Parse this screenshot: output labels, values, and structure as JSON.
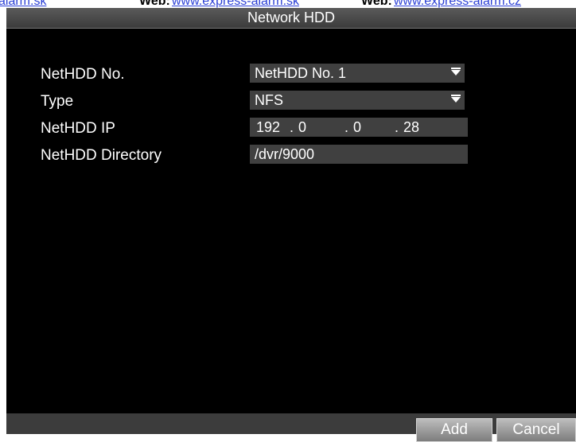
{
  "web_header": {
    "left_link": "alarm.sk",
    "label1": "Web:",
    "link1": "www.express-alarm.sk",
    "label2": "Web:",
    "link2": "www.express-alarm.cz"
  },
  "dialog": {
    "title": "Network HDD",
    "fields": {
      "nethdd_no": {
        "label": "NetHDD No.",
        "value": "NetHDD No. 1"
      },
      "type": {
        "label": "Type",
        "value": "NFS"
      },
      "ip": {
        "label": "NetHDD IP",
        "octets": [
          "192",
          "0",
          "0",
          "28"
        ]
      },
      "directory": {
        "label": "NetHDD Directory",
        "value": "/dvr/9000"
      }
    },
    "buttons": {
      "add": "Add",
      "cancel": "Cancel"
    }
  },
  "icons": {
    "dropdown_arrow": "chevron-down-icon"
  },
  "colors": {
    "window_bg": "#000000",
    "field_bg": "#404040",
    "text": "#ffffff"
  }
}
